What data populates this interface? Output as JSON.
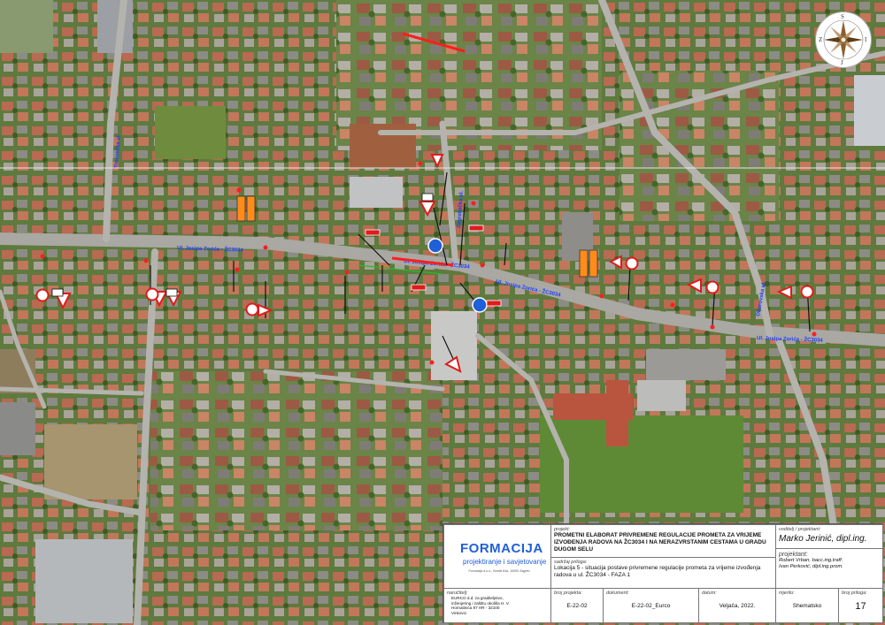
{
  "map": {
    "road_labels": [
      "Ul. Josipa Zorića - ŽC3034",
      "Ul. Josipa Zorića - ŽC3034",
      "Ul. Josipa Zorića - ŽC3034",
      "Ul. Josipa Zorića - ŽC3034",
      "Trnovečka ul.",
      "Zagrebačka ul.",
      "Oborovska ul."
    ]
  },
  "compass": {
    "north": "S",
    "south": "J",
    "east": "I",
    "west": "Z"
  },
  "company": {
    "name": "FORMACIJA",
    "tagline": "projektiranje i savjetovanje",
    "address": "Formacija d.o.o., Kireidl 64a, 10000 Zagreb"
  },
  "project": {
    "label": "projekt:",
    "title": "PROMETNI ELABORAT PRIVREMENE REGULACIJE PROMETA ZA VRIJEME IZVOĐENJA RADOVA NA ŽC3034 I NA NERAZVRSTANIM CESTAMA U GRADU DUGOM SELU"
  },
  "content": {
    "label": "sadržaj priloga:",
    "text": "Lokacija 5 - situacija postave privremene regulacije prometa za vrijeme izvođenja radova u ul. ŽC3034 - FAZA 1"
  },
  "client": {
    "label": "naručitelj:",
    "text": "EURCO d.d. za graditeljstvo, inženjering i zaštitu okoliša H. V. Hornatinića 87 HR - 32100 Vinkovci"
  },
  "lead": {
    "label": "voditelj / projektant:",
    "name": "Marko Jerinić, dipl.ing."
  },
  "designers": {
    "label": "projektant:",
    "names": [
      "Robert Vrban, bacc.ing.traff.",
      "Ivan Perković, dipl.ing.prom."
    ]
  },
  "footer": {
    "project_no_label": "broj projekta:",
    "project_no": "E-22-02",
    "document_label": "dokument:",
    "document": "E-22-02_Eurco",
    "date_label": "datum:",
    "date": "Veljača, 2022.",
    "scale_label": "mjerilo:",
    "scale": "Shematsko",
    "appendix_label": "broj priloga:",
    "appendix": "17"
  }
}
